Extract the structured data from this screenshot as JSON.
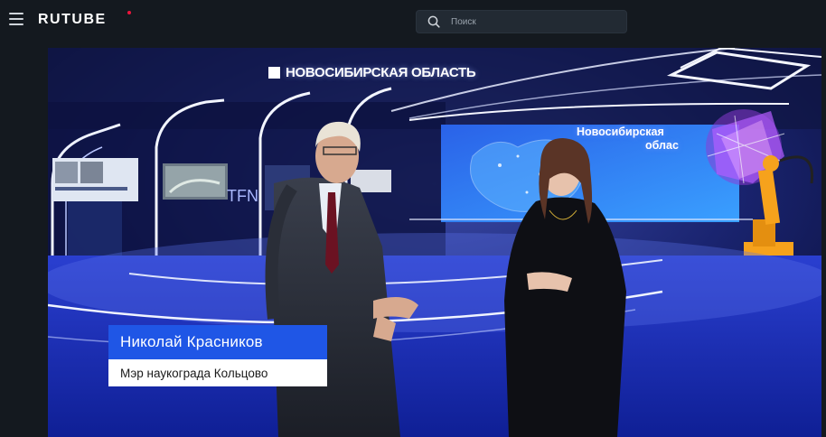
{
  "header": {
    "logo_text": "RUTUBE",
    "search_placeholder": "Поиск"
  },
  "video": {
    "stage_title": "НОВОСИБИРСКАЯ ОБЛАСТЬ",
    "screen_text_line1": "Новосибирская",
    "screen_text_line2": "облас",
    "speaker_name": "Николай Красников",
    "speaker_title": "Мэр наукограда Кольцово"
  },
  "colors": {
    "header_bg": "#14191f",
    "brand_dot": "#ed143b",
    "lower_third_blue": "#1f56e6"
  }
}
